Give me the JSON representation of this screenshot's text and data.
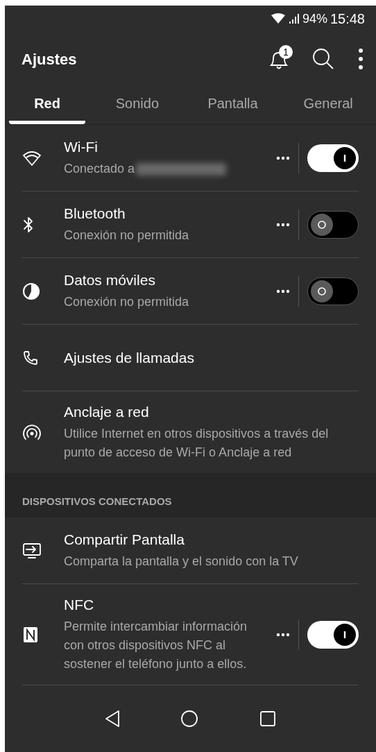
{
  "status_bar": {
    "battery": "94%",
    "time": "15:48"
  },
  "header": {
    "title": "Ajustes",
    "notification_count": "1"
  },
  "tabs": [
    {
      "label": "Red",
      "selected": true
    },
    {
      "label": "Sonido",
      "selected": false
    },
    {
      "label": "Pantalla",
      "selected": false
    },
    {
      "label": "General",
      "selected": false
    }
  ],
  "network_items": [
    {
      "title": "Wi-Fi",
      "subtitle": "Conectado a",
      "redacted": true,
      "kind": "toggle",
      "on": true
    },
    {
      "title": "Bluetooth",
      "subtitle": "Conexión no permitida",
      "kind": "toggle",
      "on": false
    },
    {
      "title": "Datos móviles",
      "subtitle": "Conexión no permitida",
      "kind": "toggle",
      "on": false
    },
    {
      "title": "Ajustes de llamadas",
      "kind": "plain"
    },
    {
      "title": "Anclaje a red",
      "subtitle": "Utilice Internet en otros dispositivos a través del punto de acceso de Wi-Fi o Anclaje a red",
      "kind": "plain"
    }
  ],
  "section": {
    "title": "DISPOSITIVOS CONECTADOS"
  },
  "device_items": [
    {
      "title": "Compartir Pantalla",
      "subtitle": "Comparta la pantalla y el sonido con la TV",
      "kind": "plain"
    },
    {
      "title": "NFC",
      "subtitle": "Permite intercambiar información con otros dispositivos NFC al sostener el teléfono junto a ellos.",
      "kind": "toggle",
      "on": true
    }
  ]
}
